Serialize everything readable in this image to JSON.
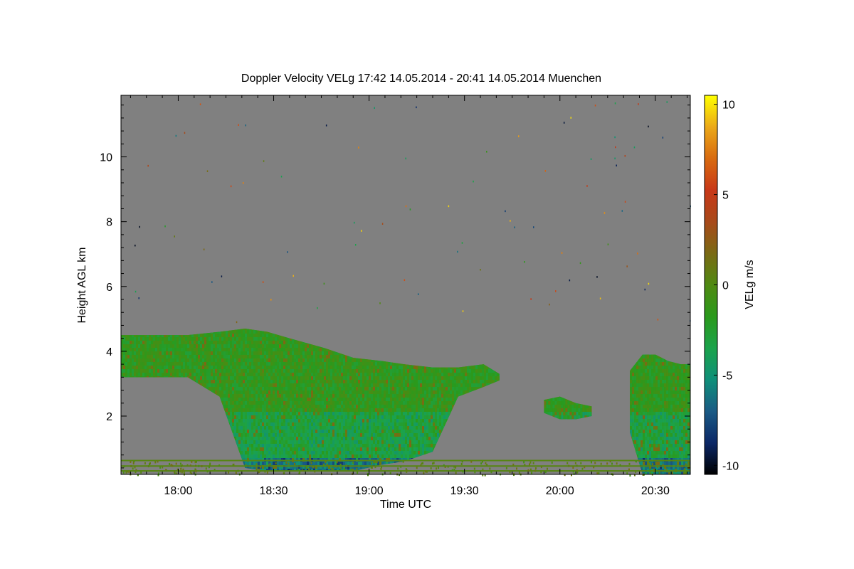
{
  "chart_data": {
    "type": "heatmap",
    "title": "Doppler Velocity VELg   17:42 14.05.2014 - 20:41 14.05.2014 Muenchen",
    "xlabel": "Time UTC",
    "ylabel": "Height AGL km",
    "colorbar_label": "VELg m/s",
    "x_ticks": [
      "18:00",
      "18:30",
      "19:00",
      "19:30",
      "20:00",
      "20:30"
    ],
    "x_tick_minutes": [
      1080,
      1110,
      1140,
      1170,
      1200,
      1230
    ],
    "y_ticks": [
      2,
      4,
      6,
      8,
      10
    ],
    "colorbar_ticks": [
      10,
      5,
      0,
      -5,
      -10
    ],
    "xlim_minutes": [
      1062,
      1241
    ],
    "ylim_km": [
      0.2,
      11.9
    ],
    "clim": [
      -10.5,
      10.5
    ],
    "background_color": "#808080",
    "colormap": [
      "#000000",
      "#0b2766",
      "#1a5a85",
      "#0f8f7a",
      "#1ba34c",
      "#2a9a1c",
      "#4f8a12",
      "#7a6a14",
      "#a84a1a",
      "#c83818",
      "#d86a10",
      "#eba818",
      "#ffff00"
    ],
    "cloud_regions": [
      {
        "description": "main cloud layer",
        "x": [
          1062,
          1072,
          1083,
          1093,
          1101,
          1108,
          1115,
          1126,
          1135,
          1144,
          1151,
          1160,
          1168,
          1176,
          1181
        ],
        "top_km": [
          4.5,
          4.5,
          4.5,
          4.6,
          4.7,
          4.6,
          4.4,
          4.1,
          3.8,
          3.7,
          3.6,
          3.5,
          3.5,
          3.6,
          3.3
        ],
        "base_km": [
          3.2,
          3.2,
          3.2,
          2.6,
          0.4,
          0.3,
          0.3,
          0.3,
          0.3,
          0.5,
          0.6,
          0.9,
          2.6,
          2.9,
          3.1
        ]
      },
      {
        "description": "mid-level patch 20:00",
        "x": [
          1195,
          1200,
          1205,
          1210
        ],
        "top_km": [
          2.5,
          2.6,
          2.4,
          2.3
        ],
        "base_km": [
          2.1,
          1.9,
          1.9,
          2.0
        ]
      },
      {
        "description": "late cloud",
        "x": [
          1222,
          1226,
          1230,
          1234,
          1238,
          1241
        ],
        "top_km": [
          3.4,
          3.9,
          3.9,
          3.7,
          3.6,
          3.6
        ],
        "base_km": [
          1.5,
          0.2,
          0.2,
          0.2,
          0.2,
          0.2
        ]
      }
    ]
  }
}
